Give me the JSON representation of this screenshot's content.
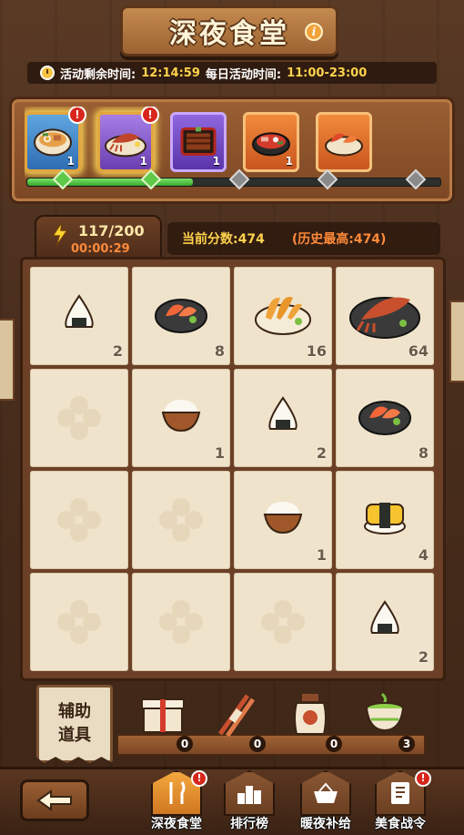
{
  "title": "深夜食堂",
  "timer": {
    "label": "活动剩余时间:",
    "value": "12:14:59",
    "daily_label": "每日活动时间:",
    "daily_value": "11:00-23:00"
  },
  "dishes": [
    {
      "name": "ramen-bowl",
      "count": "1",
      "alert": "!"
    },
    {
      "name": "grilled-squid",
      "count": "1",
      "alert": "!"
    },
    {
      "name": "eel-box",
      "count": "1",
      "alert": ""
    },
    {
      "name": "hotpot",
      "count": "1",
      "alert": ""
    },
    {
      "name": "seafood-platter",
      "count": "",
      "alert": ""
    }
  ],
  "progress": {
    "filled_fraction": 0.4
  },
  "energy": {
    "value": "117/200",
    "timer": "00:00:29"
  },
  "score": {
    "current": "当前分数:474",
    "best": "(历史最高:474)"
  },
  "grid": [
    [
      "2",
      "8",
      "16",
      "64"
    ],
    [
      "",
      "1",
      "2",
      "8"
    ],
    [
      "",
      "",
      "1",
      "4"
    ],
    [
      "",
      "",
      "",
      "2"
    ]
  ],
  "helper": {
    "label_line1": "辅助",
    "label_line2": "道具"
  },
  "tools": [
    {
      "name": "gift-box-icon",
      "count": "0"
    },
    {
      "name": "chopsticks-icon",
      "count": "0"
    },
    {
      "name": "sauce-jar-icon",
      "count": "0"
    },
    {
      "name": "tea-cup-icon",
      "count": "3"
    }
  ],
  "nav": [
    {
      "label": "深夜食堂",
      "alert": "!"
    },
    {
      "label": "排行榜",
      "alert": ""
    },
    {
      "label": "暖夜补给",
      "alert": ""
    },
    {
      "label": "美食战令",
      "alert": "!"
    }
  ]
}
